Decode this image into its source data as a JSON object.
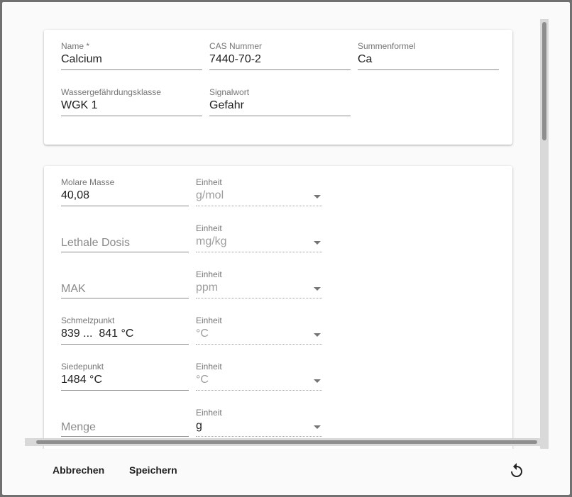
{
  "general": {
    "name": {
      "label": "Name *",
      "value": "Calcium"
    },
    "cas": {
      "label": "CAS Nummer",
      "value": "7440-70-2"
    },
    "formula": {
      "label": "Summenformel",
      "value": "Ca"
    },
    "wgk": {
      "label": "Wassergefährdungsklasse",
      "value": "WGK 1"
    },
    "signal": {
      "label": "Signalwort",
      "value": "Gefahr"
    }
  },
  "properties": {
    "unit_label": "Einheit",
    "molar_mass": {
      "label": "Molare Masse",
      "value": "40,08",
      "unit": "g/mol"
    },
    "lethal_dose": {
      "placeholder": "Lethale Dosis",
      "unit": "mg/kg"
    },
    "mak": {
      "placeholder": "MAK",
      "unit": "ppm"
    },
    "melting_point": {
      "label": "Schmelzpunkt",
      "value": "839 ...  841 °C",
      "unit": "°C"
    },
    "boiling_point": {
      "label": "Siedepunkt",
      "value": "1484 °C",
      "unit": "°C"
    },
    "amount": {
      "placeholder": "Menge",
      "unit": "g"
    }
  },
  "actions": {
    "cancel": "Abbrechen",
    "save": "Speichern",
    "reset_icon": "reset-icon"
  }
}
